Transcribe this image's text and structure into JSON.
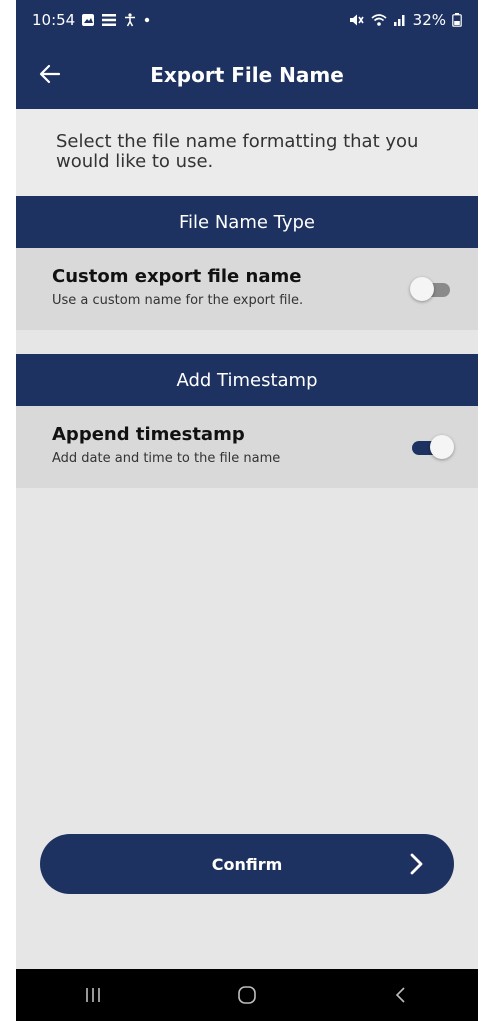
{
  "status_bar": {
    "time": "10:54",
    "left_icons": [
      "gallery-icon",
      "menu-lines-icon",
      "accessibility-icon",
      "dot-icon"
    ],
    "battery": "32%",
    "right_icons": [
      "mute-icon",
      "wifi-icon",
      "signal-icon",
      "battery-icon"
    ]
  },
  "header": {
    "title": "Export File Name",
    "back_icon": "arrow-left-icon"
  },
  "intro_text": "Select the file name formatting that you would like to use.",
  "sections": [
    {
      "header": "File Name Type",
      "setting": {
        "title": "Custom export file name",
        "description": "Use a custom name for the export file.",
        "enabled": false
      }
    },
    {
      "header": "Add Timestamp",
      "setting": {
        "title": "Append timestamp",
        "description": "Add date and time to the file name",
        "enabled": true
      }
    }
  ],
  "confirm_button": {
    "label": "Confirm",
    "icon": "chevron-right-icon"
  },
  "nav_bar": {
    "buttons": [
      "recent-apps-icon",
      "home-icon",
      "back-icon"
    ]
  },
  "colors": {
    "primary": "#1e3261",
    "background": "#e6e6e6",
    "row_background": "#d9d9d9",
    "toggle_off": "#8a8a8a"
  }
}
